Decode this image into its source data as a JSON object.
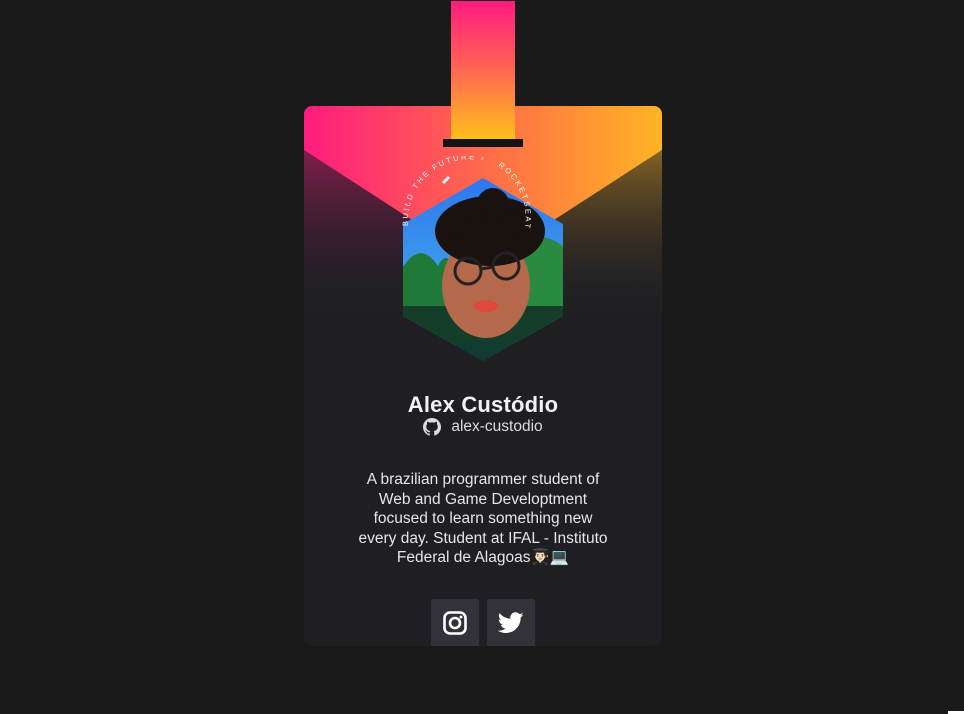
{
  "profile": {
    "name": "Alex Custódio",
    "github_user": "alex-custodio",
    "bio": "A brazilian programmer student of Web and Game Developtment focused to learn something new every day. Student at IFAL - Instituto Federal de Alagoas👨🏻‍🎓💻",
    "avatar_ring_text": "BUILD THE FUTURE · ROCKETSEAT ·"
  },
  "socials": [
    {
      "name": "instagram",
      "icon": "instagram-icon"
    },
    {
      "name": "twitter",
      "icon": "twitter-icon"
    }
  ],
  "colors": {
    "background": "#1a1a1a",
    "card": "#1f1f23",
    "button": "#323238",
    "gradient_start": "#ff1b7f",
    "gradient_mid": "#ff5f57",
    "gradient_end": "#ffc21a"
  }
}
